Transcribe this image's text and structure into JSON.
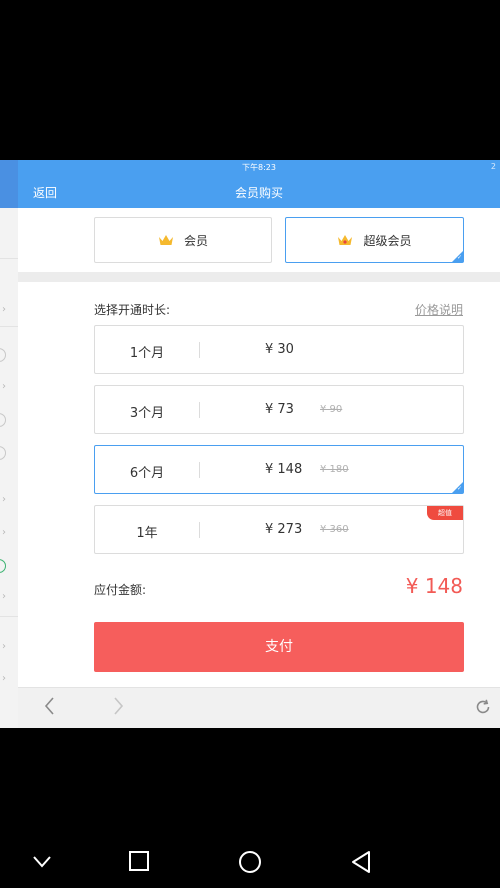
{
  "status_bar": {
    "time": "下午8:23",
    "edge_text": "2"
  },
  "nav": {
    "back_label": "返回",
    "title": "会员购买"
  },
  "tiers": [
    {
      "label": "会员",
      "selected": false
    },
    {
      "label": "超级会员",
      "selected": true
    }
  ],
  "duration": {
    "label": "选择开通时长:",
    "price_info_link": "价格说明"
  },
  "plans": [
    {
      "name": "1个月",
      "price": "¥ 30",
      "original": "",
      "badge": "",
      "selected": false
    },
    {
      "name": "3个月",
      "price": "¥ 73",
      "original": "¥ 90",
      "badge": "",
      "selected": false
    },
    {
      "name": "6个月",
      "price": "¥ 148",
      "original": "¥ 180",
      "badge": "",
      "selected": true
    },
    {
      "name": "1年",
      "price": "¥ 273",
      "original": "¥ 360",
      "badge": "超值",
      "selected": false
    }
  ],
  "payment": {
    "due_label": "应付金额:",
    "due_amount": "¥ 148",
    "pay_button": "支付"
  },
  "colors": {
    "accent": "#4a9ff0",
    "price_red": "#f25a55",
    "pay_button": "#f65e5c",
    "badge_red": "#ef4b3f",
    "crown_gold": "#f5b92e"
  },
  "icons": {
    "toolbar": [
      "back-arrow-icon",
      "forward-arrow-icon",
      "refresh-icon"
    ],
    "android_nav": [
      "chevron-down-icon",
      "recents-square-icon",
      "home-circle-icon",
      "back-triangle-icon"
    ]
  }
}
